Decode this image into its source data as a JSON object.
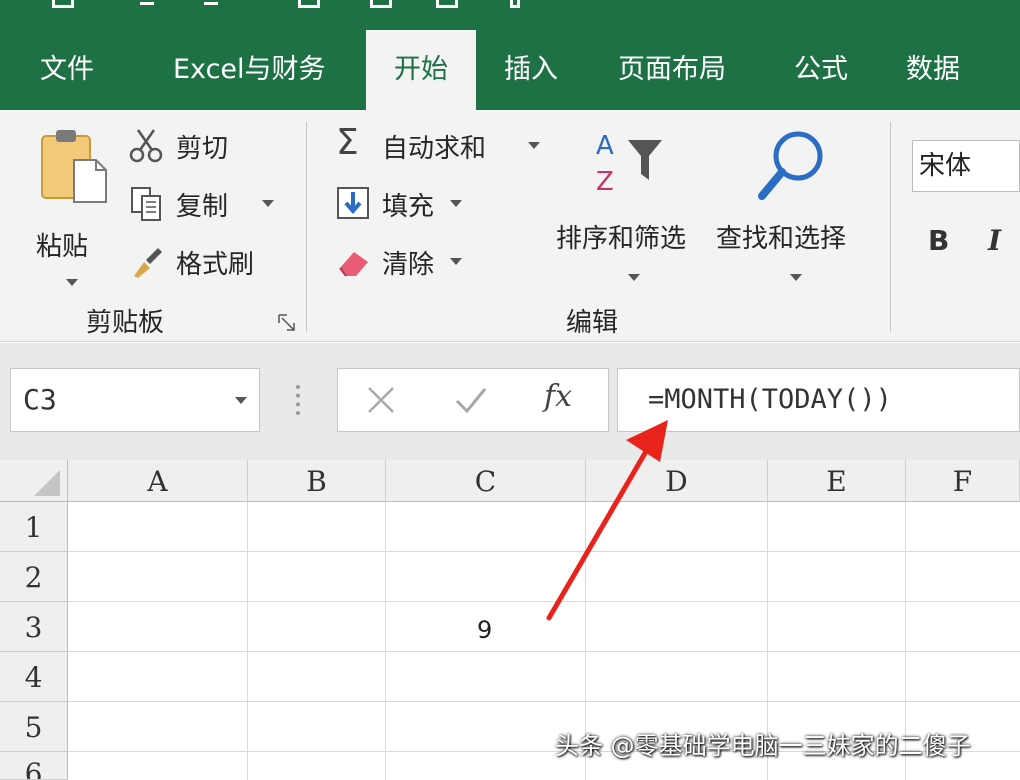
{
  "tabs": [
    {
      "label": "文件",
      "active": false
    },
    {
      "label": "Excel与财务",
      "active": false
    },
    {
      "label": "开始",
      "active": true
    },
    {
      "label": "插入",
      "active": false
    },
    {
      "label": "页面布局",
      "active": false
    },
    {
      "label": "公式",
      "active": false
    },
    {
      "label": "数据",
      "active": false
    }
  ],
  "clipboard": {
    "paste": "粘贴",
    "cut": "剪切",
    "copy": "复制",
    "format_painter": "格式刷",
    "group_label": "剪贴板"
  },
  "editing": {
    "autosum": "自动求和",
    "fill": "填充",
    "clear": "清除",
    "sort_filter": "排序和筛选",
    "find_select": "查找和选择",
    "group_label": "编辑"
  },
  "font": {
    "name": "宋体",
    "bold": "B",
    "italic": "I"
  },
  "formula_bar": {
    "name_box": "C3",
    "fx": "fx",
    "formula": "=MONTH(TODAY())"
  },
  "grid": {
    "columns": [
      "A",
      "B",
      "C",
      "D",
      "E",
      "F"
    ],
    "rows": [
      "1",
      "2",
      "3",
      "4",
      "5",
      "6"
    ],
    "cells": {
      "C3": "9"
    }
  },
  "watermark": "头条 @零基础学电脑一三妹家的二傻子",
  "colors": {
    "brand_green": "#1e7145",
    "arrow_red": "#e8231b"
  },
  "icons": [
    "clipboard-paste-icon",
    "scissors-icon",
    "copy-icon",
    "brush-icon",
    "sigma-icon",
    "fill-down-icon",
    "eraser-icon",
    "sort-filter-icon",
    "magnifier-icon",
    "cancel-icon",
    "enter-icon",
    "dialog-launcher-icon"
  ]
}
